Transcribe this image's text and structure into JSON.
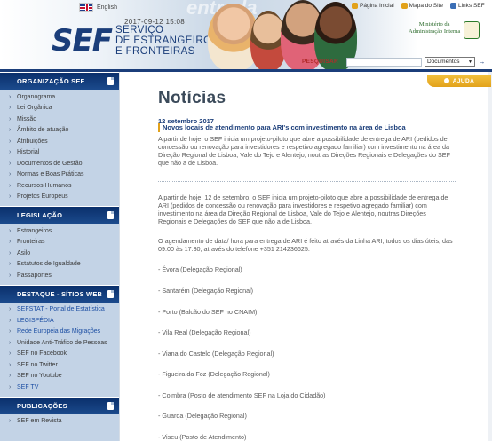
{
  "header": {
    "language_label": "English",
    "datetime": "2017-09-12 15:08",
    "logo_text": "SEF",
    "org_name_line1": "SERVIÇO",
    "org_name_line2": "DE ESTRANGEIROS",
    "org_name_line3": "E FRONTEIRAS",
    "background_word": "entrada",
    "top_links": [
      "Página Inicial",
      "Mapa do Site",
      "Links SEF"
    ],
    "ministry_line1": "Ministério da",
    "ministry_line2": "Administração Interna",
    "search_label": "PESQUISAR",
    "search_value": "",
    "search_scope": "Documentos",
    "help_label": "AJUDA",
    "colors": {
      "brand_blue": "#1b3e7a",
      "accent_orange": "#e2a21b",
      "sidebar_bg": "#c3d3e6"
    }
  },
  "sidebar": {
    "sections": [
      {
        "title": "ORGANIZAÇÃO SEF",
        "items": [
          "Organograma",
          "Lei Orgânica",
          "Missão",
          "Âmbito de atuação",
          "Atribuições",
          "Historial",
          "Documentos de Gestão",
          "Normas e Boas Práticas",
          "Recursos Humanos",
          "Projetos Europeus"
        ]
      },
      {
        "title": "LEGISLAÇÃO",
        "items": [
          "Estrangeiros",
          "Fronteiras",
          "Asilo",
          "Estatutos de Igualdade",
          "Passaportes"
        ]
      },
      {
        "title": "DESTAQUE - SÍTIOS WEB",
        "items": [
          "SEFSTAT - Portal de Estatística",
          "LEGISPÉDIA",
          "Rede Europeia das Migrações",
          "Unidade Anti-Tráfico de Pessoas",
          "SEF no Facebook",
          "SEF no Twitter",
          "SEF no Youtube",
          "SEF TV"
        ]
      },
      {
        "title": "PUBLICAÇÕES",
        "items": [
          "SEF em Revista"
        ]
      }
    ]
  },
  "main": {
    "page_title": "Notícias",
    "date": "12 setembro 2017",
    "headline": "Novos locais de atendimento para ARI's com investimento na área de Lisboa",
    "summary": "A partir de hoje, o SEF inicia um projeto-piloto que abre a possibilidade de entrega de ARI (pedidos de concessão ou renovação para investidores e respetivo agregado familiar) com investimento na área da Direção Regional de Lisboa, Vale do Tejo e Alentejo, noutras Direções Regionais e Delegações do SEF que não a de Lisboa.",
    "body_p1": "A partir de hoje, 12 de setembro, o SEF inicia um projeto-piloto que abre a possibilidade de entrega de ARI (pedidos de concessão ou renovação para investidores e respetivo agregado familiar) com investimento na área da Direção Regional de Lisboa, Vale do Tejo e Alentejo, noutras Direções Regionais e Delegações do SEF que não a de Lisboa.",
    "body_p2": "O agendamento de data/ hora para entrega de ARI é feito através da Linha ARI, todos os dias úteis, das 09:00 às 17:30, através do telefone +351 214236625.",
    "locations": [
      "- Évora (Delegação Regional)",
      "- Santarém (Delegação Regional)",
      "- Porto (Balcão do SEF no CNAIM)",
      "- Vila Real (Delegação Regional)",
      "- Viana do Castelo (Delegação Regional)",
      "- Figueira da Foz (Delegação Regional)",
      "- Coimbra (Posto de atendimento SEF na Loja do Cidadão)",
      "- Guarda (Delegação Regional)",
      "- Viseu (Posto de Atendimento)"
    ]
  }
}
